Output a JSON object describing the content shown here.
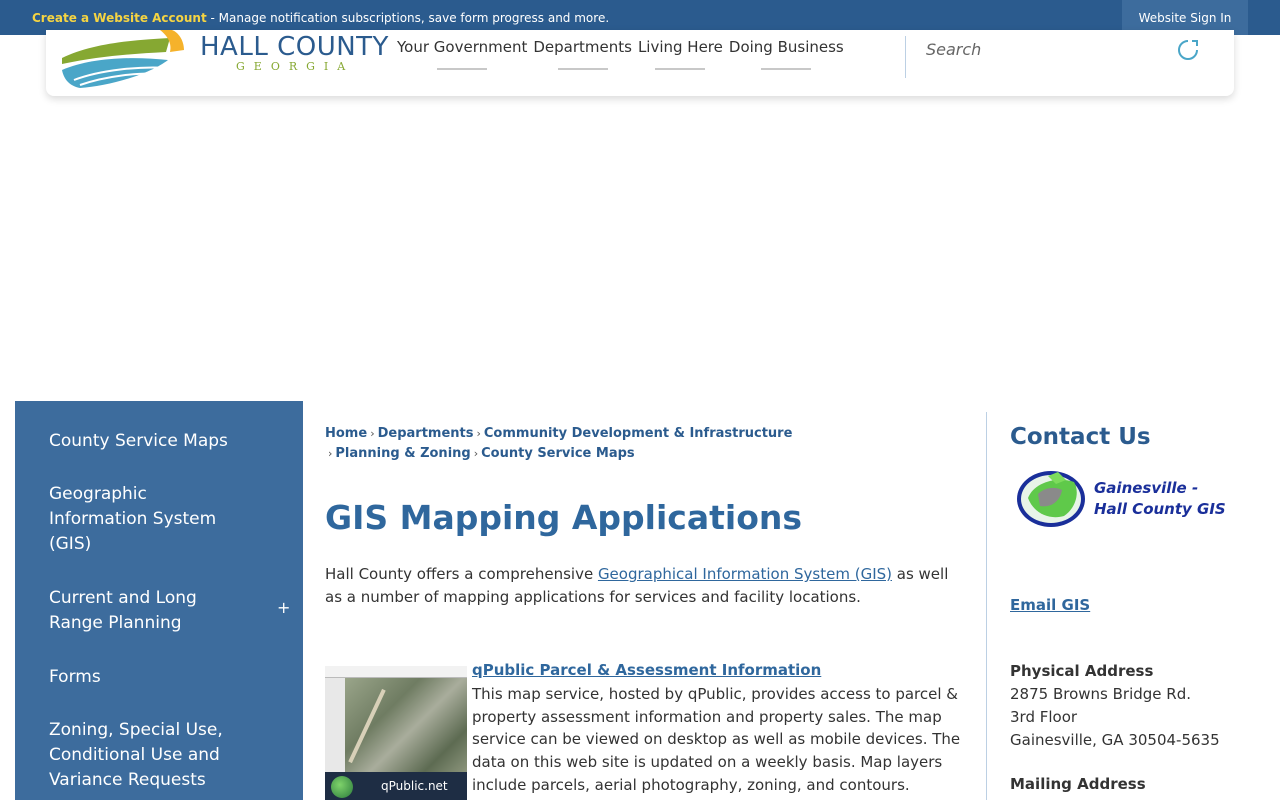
{
  "topbar": {
    "create_link": "Create a Website Account",
    "message": " - Manage notification subscriptions, save form progress and more.",
    "signin_label": "Website Sign In"
  },
  "header": {
    "logo_text": "HALL COUNTY",
    "logo_sub": "GEORGIA",
    "nav": [
      "Your Government",
      "Departments",
      "Living Here",
      "Doing Business"
    ],
    "search_placeholder": "Search"
  },
  "sidebar": {
    "items": [
      {
        "label": "County Service Maps"
      },
      {
        "label": "Geographic Information System (GIS)"
      },
      {
        "label": "Current and Long Range Planning",
        "toggle": "+"
      },
      {
        "label": "Forms"
      },
      {
        "label": "Zoning, Special Use, Conditional Use and Variance Requests"
      }
    ]
  },
  "breadcrumb": {
    "items": [
      "Home",
      "Departments",
      "Community Development & Infrastructure",
      "Planning & Zoning",
      "County Service Maps"
    ],
    "separator": "›"
  },
  "main": {
    "title": "GIS Mapping Applications",
    "intro_before": "Hall County offers a comprehensive ",
    "intro_link": "Geographical Information System (GIS)",
    "intro_after": " as well as a number of mapping applications for services and facility locations.",
    "item": {
      "thumb_label": "qPublic.net",
      "title": "qPublic Parcel & Assessment Information",
      "description": "This map service, hosted by qPublic, provides access to parcel & property assessment information and property sales. The map service can be viewed on desktop as well as mobile devices. The data on this web site is updated on a weekly basis. Map layers include parcels, aerial photography, zoning, and contours."
    }
  },
  "contact": {
    "title": "Contact Us",
    "logo_line1": "Gainesville -",
    "logo_line2": "Hall County GIS",
    "email_label": "Email GIS",
    "physical_label": "Physical Address",
    "physical_lines": [
      "2875 Browns Bridge Rd.",
      "3rd Floor",
      "Gainesville, GA 30504-5635"
    ],
    "mailing_label": "Mailing Address"
  },
  "colors": {
    "brand_blue": "#2b5b8e",
    "sidebar_blue": "#3d6c9d",
    "accent_yellow": "#f5d442"
  }
}
